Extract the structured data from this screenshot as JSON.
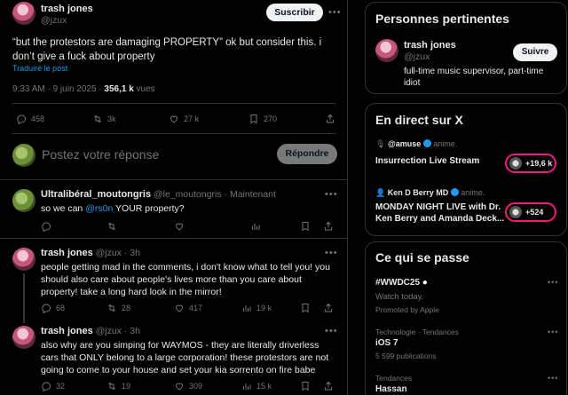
{
  "main_tweet": {
    "author_name": "trash jones",
    "author_handle": "@jzux",
    "follow_label": "Suscribir",
    "text": "“but the protestors are damaging PROPERTY” ok but consider this. i don’t give a fuck about property",
    "translate_label": "Traduire le post",
    "time": "9:33 AM · 9 juin 2025 · ",
    "views_count": "356,1 k",
    "views_label": " vues",
    "replies": "458",
    "reposts": "3k",
    "likes": "27 k",
    "bookmarks": "270"
  },
  "composer": {
    "placeholder": "Postez votre réponse",
    "button_label": "Répondre"
  },
  "replies": [
    {
      "name": "Ultralibéral_moutongris",
      "handle": "@le_moutongris · Maintenant",
      "text_before": "so we can ",
      "mention": "@rs0n",
      "text_after": " YOUR property?"
    },
    {
      "name": "trash jones",
      "handle": "@jzux · 3h",
      "text": "people getting mad in the comments, i don't know what to tell you! you should also care about people's lives more than you care about property! take a long hard look in the mirror!",
      "replies": "68",
      "reposts": "28",
      "likes": "417",
      "views": "19 k"
    },
    {
      "name": "trash jones",
      "handle": "@jzux · 3h",
      "text": "also why are you simping for WAYMOS - they are literally driverless cars that ONLY belong to a large corporation! these protestors are not going to come to your house and set your kia sorrento on fire babe",
      "replies": "32",
      "reposts": "19",
      "likes": "309",
      "views": "15 k"
    }
  ],
  "sidebar": {
    "relevant": {
      "title": "Personnes pertinentes",
      "name": "trash jones",
      "handle": "@jzux",
      "follow_label": "Suivre",
      "bio": "full-time music supervisor, part-time idiot"
    },
    "live": {
      "title": "En direct sur X",
      "items": [
        {
          "host": "@amuse",
          "suffix": " anime.",
          "title": "Insurrection Live Stream",
          "count": "+19,6 k"
        },
        {
          "host": "Ken D Berry MD",
          "suffix": " anime.",
          "title": "MONDAY NIGHT LIVE with Dr. Ken Berry and Amanda Deck...",
          "count": "+524"
        }
      ]
    },
    "trends": {
      "title": "Ce qui se passe",
      "items": [
        {
          "name": "#WWDC25",
          "line1": "Watch today.",
          "line2": "Promoted by Apple"
        },
        {
          "category": "Technologie · Tendances",
          "name": "iOS 7",
          "line1": "5 599 publications"
        },
        {
          "category": "Tendances",
          "name": "Hassan"
        }
      ]
    }
  },
  "colors": {
    "accent": "#1d9bf0",
    "live_ring": "#f91880",
    "background": "#000000"
  }
}
